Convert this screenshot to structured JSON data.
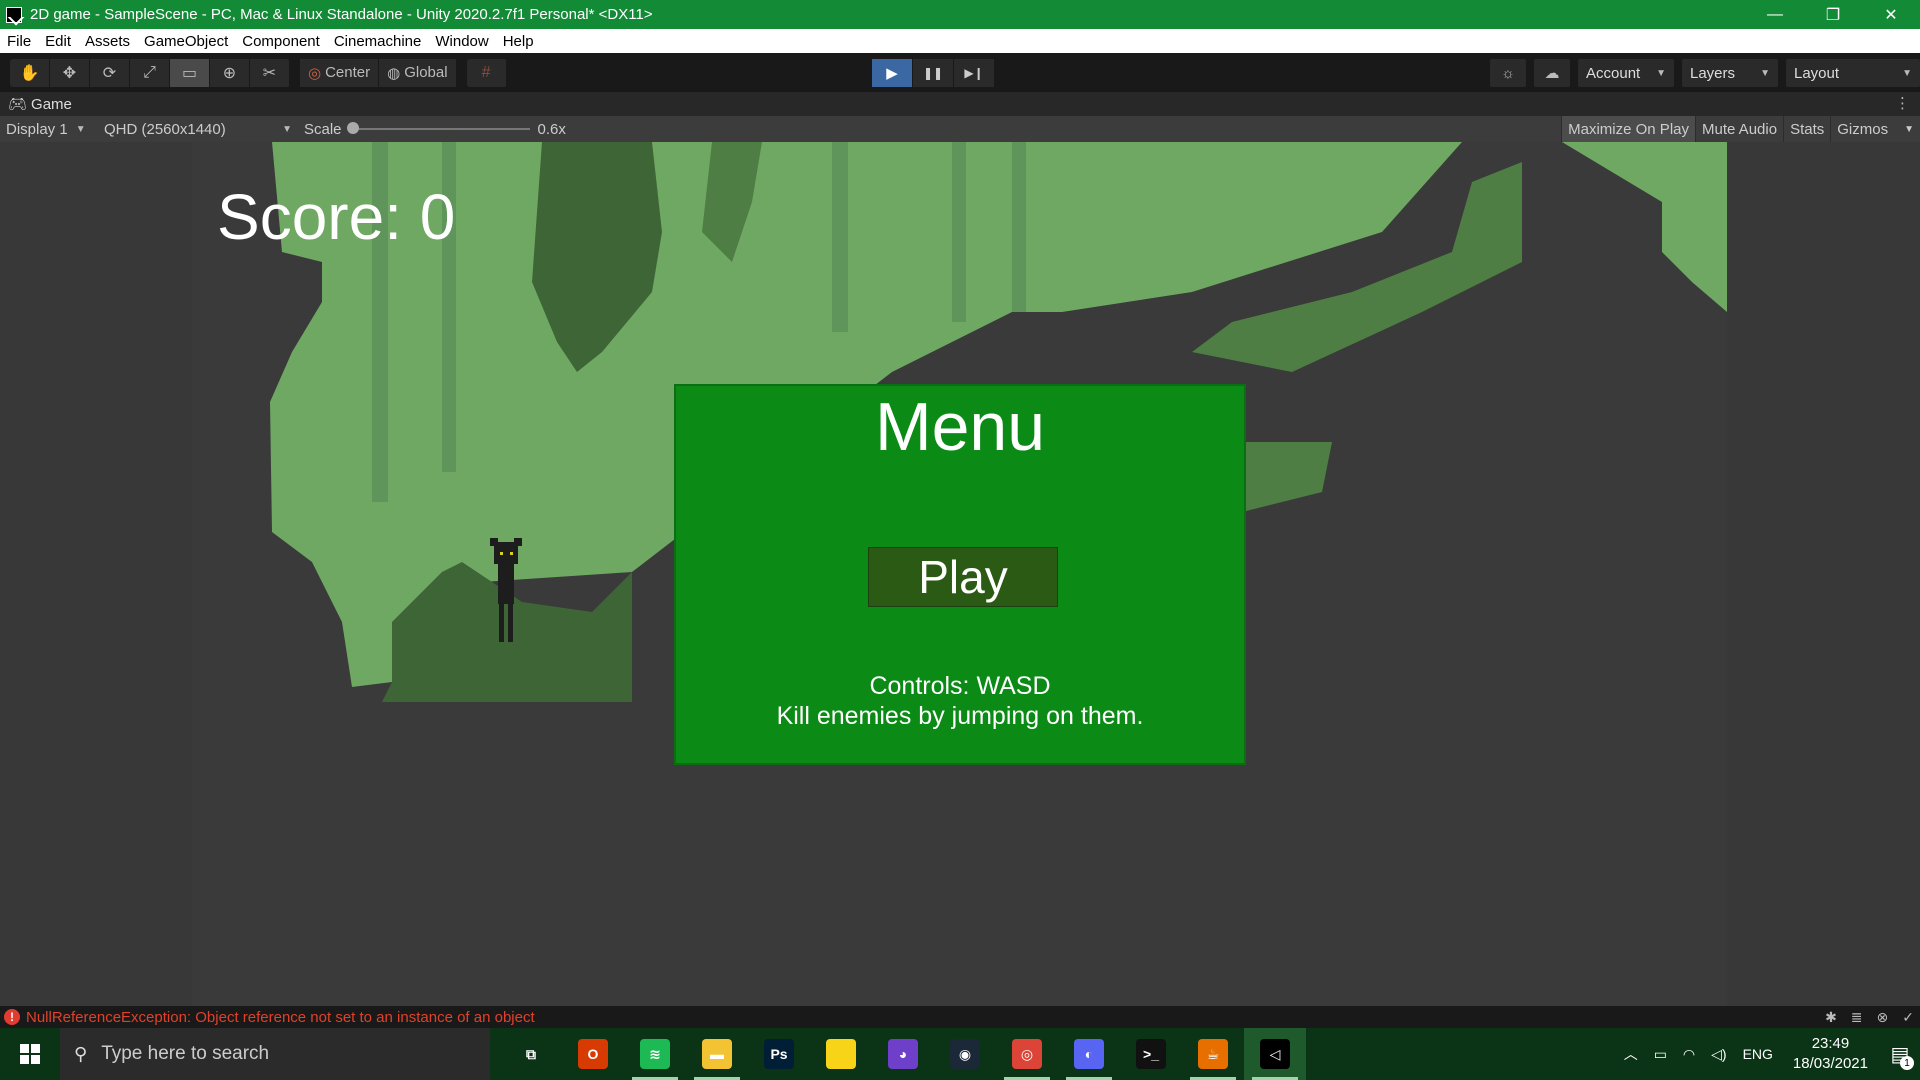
{
  "window": {
    "title": "2D game - SampleScene - PC, Mac & Linux Standalone - Unity 2020.2.7f1 Personal* <DX11>",
    "controls": [
      "—",
      "❐",
      "✕"
    ]
  },
  "menubar": [
    "File",
    "Edit",
    "Assets",
    "GameObject",
    "Component",
    "Cinemachine",
    "Window",
    "Help"
  ],
  "toolbar": {
    "tools": [
      {
        "name": "hand-tool",
        "icon": "✋"
      },
      {
        "name": "move-tool",
        "icon": "✥"
      },
      {
        "name": "rotate-tool",
        "icon": "⟳"
      },
      {
        "name": "scale-tool",
        "icon": "⤢"
      },
      {
        "name": "rect-tool",
        "icon": "▭"
      },
      {
        "name": "transform-tool",
        "icon": "⊕"
      },
      {
        "name": "custom-tool",
        "icon": "✂"
      }
    ],
    "pivot_label": "Center",
    "space_label": "Global",
    "grid_icon": "#",
    "play_icon": "▶",
    "pause_icon": "❚❚",
    "step_icon": "▶❙",
    "account_label": "Account",
    "layers_label": "Layers",
    "layout_label": "Layout"
  },
  "game_tab": {
    "label": "Game",
    "display": "Display 1",
    "resolution": "QHD (2560x1440)",
    "scale_label": "Scale",
    "scale_value": "0.6x",
    "scale_fraction": 0.02,
    "maximize_on_play": "Maximize On Play",
    "mute_audio": "Mute Audio",
    "stats": "Stats",
    "gizmos": "Gizmos"
  },
  "game": {
    "score_text": "Score: 0",
    "menu": {
      "title": "Menu",
      "play_button": "Play",
      "controls_line1": "Controls: WASD",
      "controls_line2": "Kill enemies by jumping on them."
    }
  },
  "status": {
    "error_icon": "!",
    "error_text": "NullReferenceException: Object reference not set to an instance of an object"
  },
  "taskbar": {
    "search_placeholder": "Type here to search",
    "apps": [
      {
        "name": "task-view",
        "label": "⧉",
        "color": "#0b3315"
      },
      {
        "name": "office",
        "label": "O",
        "color": "#d83b01"
      },
      {
        "name": "spotify",
        "label": "≋",
        "color": "#1db954"
      },
      {
        "name": "file-explorer",
        "label": "▬",
        "color": "#f3c334"
      },
      {
        "name": "photoshop",
        "label": "Ps",
        "color": "#001e36"
      },
      {
        "name": "sticky-notes",
        "label": "",
        "color": "#f7d417"
      },
      {
        "name": "github",
        "label": "◕",
        "color": "#6e40c9"
      },
      {
        "name": "steam",
        "label": "◉",
        "color": "#1b2838"
      },
      {
        "name": "chrome",
        "label": "◎",
        "color": "#db4437"
      },
      {
        "name": "discord",
        "label": "◐",
        "color": "#5865f2"
      },
      {
        "name": "terminal",
        "label": ">_",
        "color": "#111"
      },
      {
        "name": "java",
        "label": "☕",
        "color": "#e76f00"
      },
      {
        "name": "unity",
        "label": "◁",
        "color": "#000"
      }
    ],
    "tray_language": "ENG",
    "time": "23:49",
    "date": "18/03/2021",
    "notification_count": "1"
  },
  "colors": {
    "title_bar": "#138a36",
    "menu_panel": "#0b8a16",
    "play_button": "#2a5a14",
    "error_text": "#e0412c",
    "scene_light_green": "#6fa863",
    "scene_mid_green": "#4f7e45",
    "scene_dark_green": "#3d6535"
  }
}
